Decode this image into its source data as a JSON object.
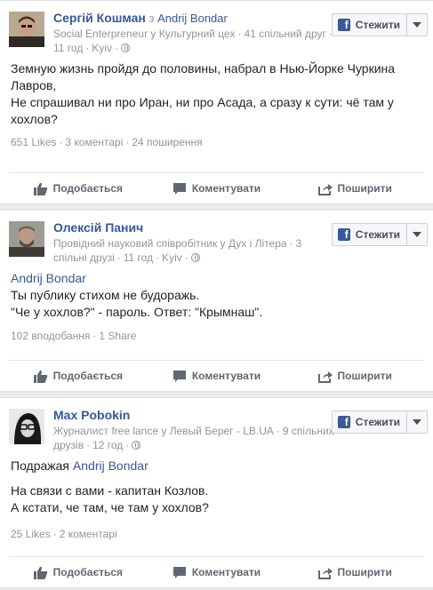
{
  "posts": [
    {
      "author": "Сергій Кошман",
      "via_prefix": "з",
      "via_name": "Andrij Bondar",
      "meta": [
        "Social Enterpreneur у Культурний цех",
        "41 спільний друг",
        "11 год",
        "Kyiv"
      ],
      "follow_label": "Стежити",
      "reference": "",
      "reference_prefix": "",
      "text_lines": [
        "Земную жизнь пройдя до половины, набрал в Нью-Йорке Чуркина",
        "Лавров,",
        "Не спрашивал ни про Иран, ни про Асада, а сразу к сути: чё там у",
        "хохлов?"
      ],
      "stats": [
        "651 Likes",
        "3 коментарі",
        "24 поширення"
      ],
      "actions": {
        "like": "Подобається",
        "comment": "Коментувати",
        "share": "Поширити"
      }
    },
    {
      "author": "Олексій Панич",
      "via_prefix": "",
      "via_name": "",
      "meta": [
        "Провідний науковий співробітник у Дух і Літера",
        "3 спільні друзі",
        "11 год",
        "Kyiv"
      ],
      "follow_label": "Стежити",
      "reference": "Andrij Bondar",
      "reference_prefix": "",
      "text_lines": [
        "Ты публику стихом не будоражь.",
        "\"Че у хохлов?\" - пароль. Ответ: \"Крымнаш\"."
      ],
      "stats": [
        "102 вподобання",
        "1 Share"
      ],
      "actions": {
        "like": "Подобається",
        "comment": "Коментувати",
        "share": "Поширити"
      }
    },
    {
      "author": "Max Pobokin",
      "via_prefix": "",
      "via_name": "",
      "meta": [
        "Журналист free lance у Левый Берег - LB.UA",
        "9 спільних друзів",
        "12 год"
      ],
      "follow_label": "Стежити",
      "reference": "Andrij Bondar",
      "reference_prefix": "Подражая",
      "text_lines": [
        "На связи с вами - капитан Козлов.",
        "А кстати, че там, че там у хохлов?"
      ],
      "stats": [
        "25 Likes",
        "2 коментарі"
      ],
      "actions": {
        "like": "Подобається",
        "comment": "Коментувати",
        "share": "Поширити"
      }
    }
  ]
}
